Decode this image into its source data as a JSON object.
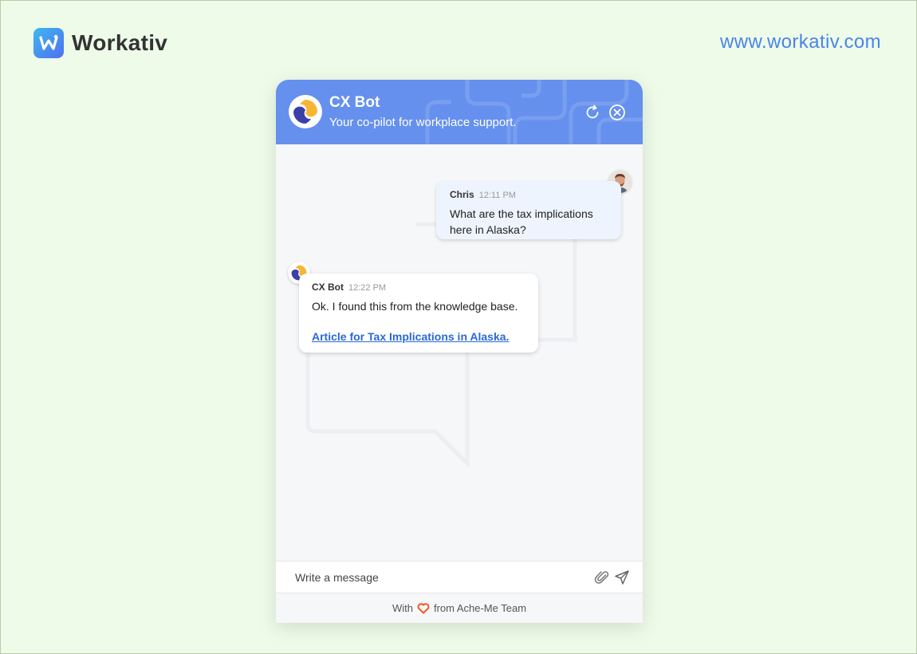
{
  "brand": {
    "name": "Workativ",
    "url": "www.workativ.com"
  },
  "widget": {
    "header": {
      "title": "CX Bot",
      "subtitle": "Your co-pilot for workplace support."
    },
    "messages": [
      {
        "sender": "Chris",
        "time": "12:11 PM",
        "text": "What are the tax implications here in Alaska?"
      },
      {
        "sender": "CX Bot",
        "time": "12:22 PM",
        "text": "Ok. I found this from the knowledge base.",
        "link_text": "Article for Tax Implications in Alaska. "
      }
    ],
    "composer": {
      "placeholder": "Write a message"
    },
    "footer": {
      "prefix": "With",
      "suffix": "from Ache-Me Team"
    }
  },
  "icons": [
    "workativ-logo-icon",
    "cx-bot-logo-icon",
    "refresh-icon",
    "close-circle-icon",
    "user-avatar-icon",
    "paperclip-icon",
    "send-icon",
    "heart-icon"
  ],
  "colors": {
    "header": "#6590ee",
    "link": "#2a68d8",
    "url": "#4a84ea",
    "heart": "#f05a28",
    "background": "#eefbe8"
  }
}
